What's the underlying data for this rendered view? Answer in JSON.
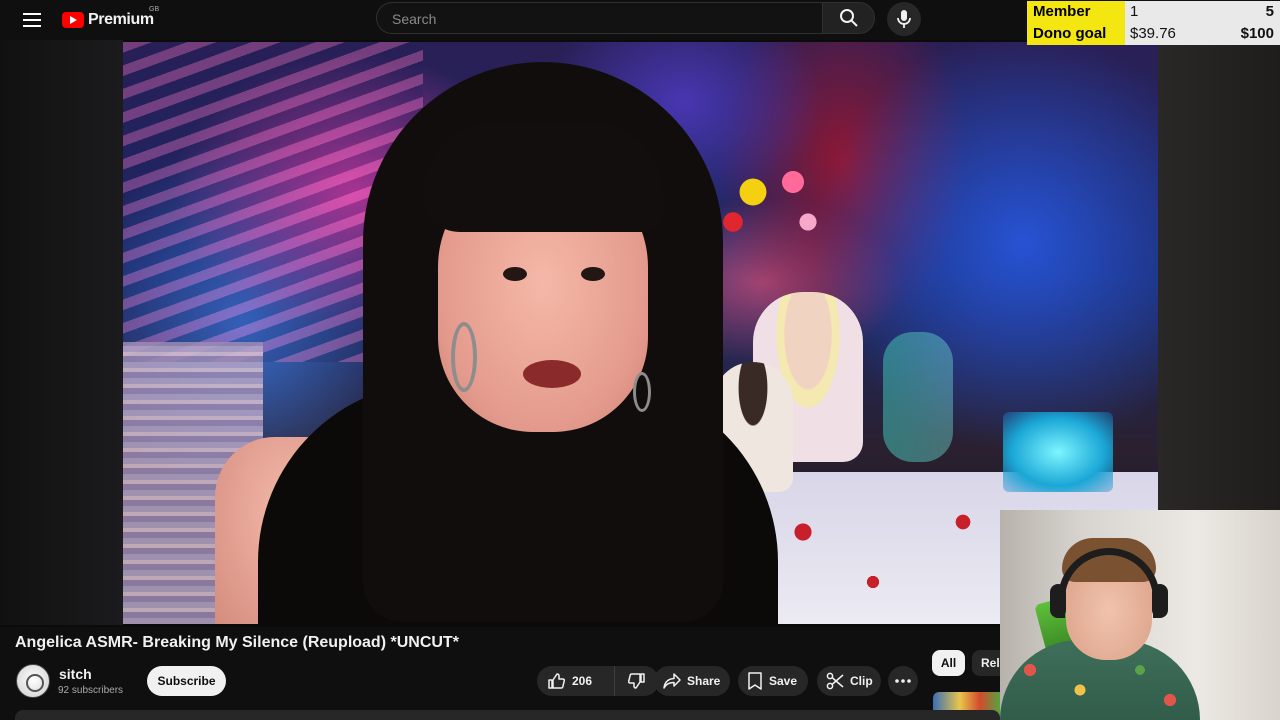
{
  "header": {
    "logo_text": "Premium",
    "logo_region": "GB",
    "search_placeholder": "Search"
  },
  "stream_goals": {
    "member_goal": {
      "label": "Member Goal",
      "current": "1",
      "target": "5"
    },
    "dono_goal": {
      "label": "Dono goal",
      "current": "$39.76",
      "target": "$100"
    }
  },
  "video": {
    "title": "Angelica ASMR- Breaking My Silence (Reupload) *UNCUT*"
  },
  "channel": {
    "name": "sitch",
    "subscribers": "92 subscribers",
    "subscribe_label": "Subscribe"
  },
  "actions": {
    "like_count": "206",
    "share_label": "Share",
    "save_label": "Save",
    "clip_label": "Clip"
  },
  "chips": {
    "all": "All",
    "related": "Related"
  },
  "colors": {
    "background": "#0f0f0f",
    "brand_red": "#ff0000",
    "goal_label_bg": "#f4e610",
    "pill_bg": "#272727"
  },
  "icons": [
    "menu-icon",
    "youtube-logo-icon",
    "search-icon",
    "microphone-icon",
    "thumbs-up-icon",
    "thumbs-down-icon",
    "share-icon",
    "bookmark-icon",
    "scissors-icon",
    "more-dots-icon"
  ]
}
